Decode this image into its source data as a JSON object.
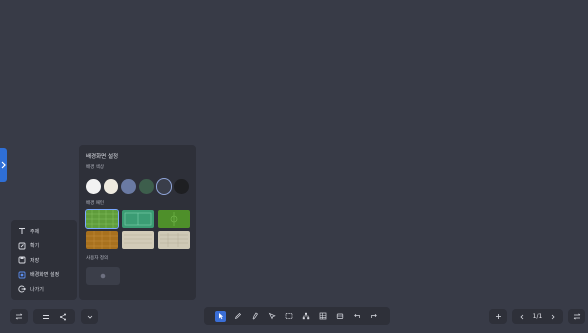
{
  "menu": {
    "items": [
      {
        "label": "주제",
        "icon": "text-icon"
      },
      {
        "label": "확기",
        "icon": "edit-box-icon"
      },
      {
        "label": "저장",
        "icon": "save-icon"
      },
      {
        "label": "배경화면 설정",
        "icon": "background-settings-icon",
        "active": true
      },
      {
        "label": "나가기",
        "icon": "exit-icon"
      }
    ]
  },
  "panel": {
    "title": "배경화면 설정",
    "color_label": "배경 색상",
    "pattern_label": "배경 패턴",
    "custom_label": "사용자 정의",
    "colors": [
      "#f2f2f2",
      "#eeeadf",
      "#6a7aa3",
      "#3d5e4c",
      "#3a3e4a",
      "#1e1f22"
    ],
    "selected_color": 4,
    "patterns": [
      {
        "name": "green-grid",
        "color": "#5f9c3b"
      },
      {
        "name": "teal-field",
        "color": "#3b9c74"
      },
      {
        "name": "green-field",
        "color": "#4e8f2a"
      },
      {
        "name": "orange-grid",
        "color": "#a8711e"
      },
      {
        "name": "beige-lines",
        "color": "#d2cbb8"
      },
      {
        "name": "beige-grid",
        "color": "#cfc9b6"
      }
    ],
    "selected_pattern": 0
  },
  "toolbar": {
    "page_indicator": "1/1"
  },
  "colors": {
    "canvas": "#383b47",
    "panel": "#2e3039",
    "accent": "#3a6ed6"
  }
}
